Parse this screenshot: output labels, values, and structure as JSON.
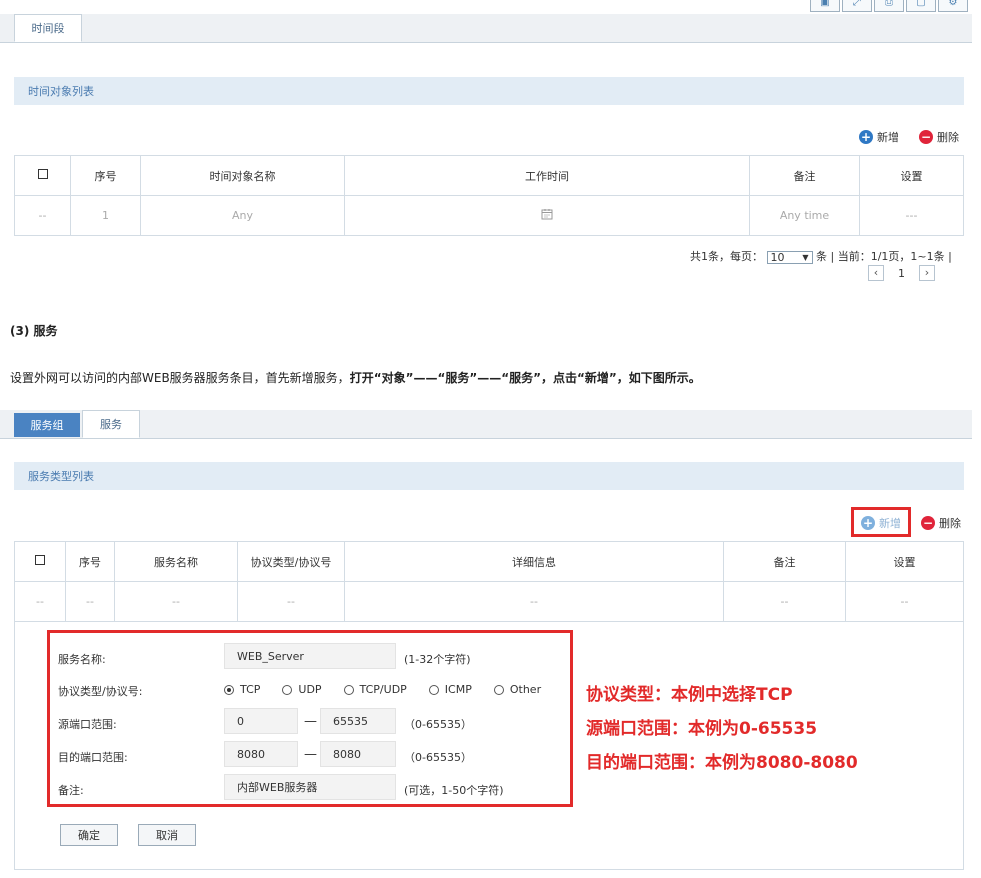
{
  "toolbar": {
    "icons": [
      "save-icon",
      "expand-icon",
      "print-icon",
      "window-icon",
      "gear-icon"
    ]
  },
  "time_section": {
    "tab_label": "时间段",
    "list_title": "时间对象列表",
    "add_label": "新增",
    "delete_label": "删除",
    "columns": [
      "序号",
      "时间对象名称",
      "工作时间",
      "备注",
      "设置"
    ],
    "row": {
      "checkbox": "--",
      "index": "1",
      "name": "Any",
      "remark": "Any time",
      "settings": "---"
    },
    "pagination": {
      "prefix": "共1条，每页：",
      "per_page": "10",
      "suffix": "条 | 当前：1/1页，1~1条 |",
      "page": "1"
    }
  },
  "service_heading": "(3) 服务",
  "instruction": {
    "normal": "设置外网可以访问的内部WEB服务器服务条目，首先新增服务，",
    "bold": "打开“对象”——“服务”——“服务”，点击“新增”，如下图所示。"
  },
  "service_section": {
    "tab_group": "服务组",
    "tab_service": "服务",
    "list_title": "服务类型列表",
    "add_label": "新增",
    "delete_label": "删除",
    "columns": [
      "序号",
      "服务名称",
      "协议类型/协议号",
      "详细信息",
      "备注",
      "设置"
    ],
    "empty_row": [
      "--",
      "--",
      "--",
      "--",
      "--",
      "--",
      "--"
    ]
  },
  "form": {
    "name_label": "服务名称:",
    "name_value": "WEB_Server",
    "name_hint": "(1-32个字符)",
    "protocol_label": "协议类型/协议号:",
    "protocols": [
      "TCP",
      "UDP",
      "TCP/UDP",
      "ICMP",
      "Other"
    ],
    "selected_protocol": "TCP",
    "src_label": "源端口范围:",
    "src_from": "0",
    "src_to": "65535",
    "src_hint": "（0-65535）",
    "dst_label": "目的端口范围:",
    "dst_from": "8080",
    "dst_to": "8080",
    "dst_hint": "（0-65535）",
    "remark_label": "备注:",
    "remark_value": "内部WEB服务器",
    "remark_hint": "(可选，1-50个字符)",
    "dash": "—",
    "ok_label": "确定",
    "cancel_label": "取消"
  },
  "annotations": [
    "协议类型：本例中选择TCP",
    "源端口范围：本例为0-65535",
    "目的端口范围：本例为8080-8080"
  ],
  "colors": {
    "accent_blue": "#4a83c2",
    "add_blue": "#2f78c4",
    "delete_red": "#e0243a",
    "highlight_red": "#e22a2a"
  }
}
